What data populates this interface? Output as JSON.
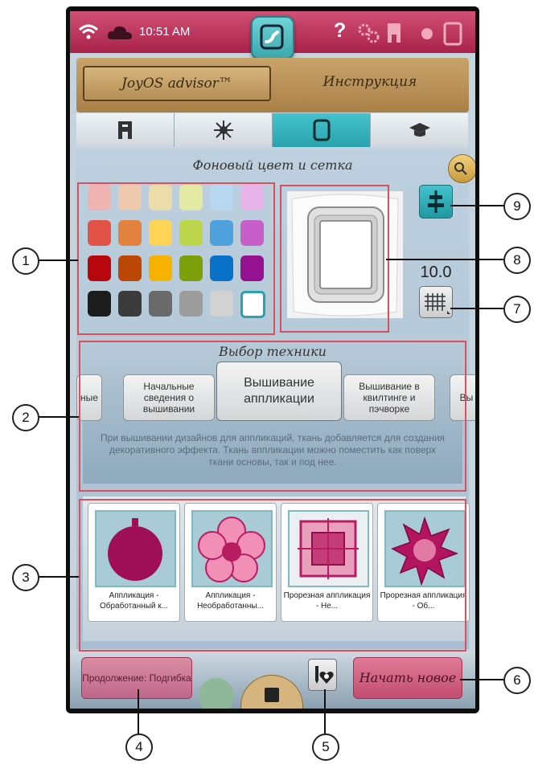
{
  "status_bar": {
    "time": "10:51 AM",
    "icons": [
      "wifi-icon",
      "cloud-icon",
      "home-icon",
      "help-icon",
      "settings-icon",
      "embroidery-unit-icon",
      "toggle-icon",
      "tablet-icon"
    ],
    "help_glyph": "?"
  },
  "header": {
    "advisor_button": "JoyOS advisor™",
    "instruction_button": "Инструкция"
  },
  "tabs": [
    {
      "icon": "sewing-machine-icon",
      "active": false
    },
    {
      "icon": "star-stitch-icon",
      "active": false
    },
    {
      "icon": "embroidery-hoop-icon",
      "active": true
    },
    {
      "icon": "graduation-cap-icon",
      "active": false
    }
  ],
  "background_section": {
    "title": "Фоновый цвет и сетка",
    "swatches": [
      "#efb3b1",
      "#efc9ae",
      "#ecdcaa",
      "#e2eaa4",
      "#b6d7ef",
      "#e8b5eb",
      "#e35246",
      "#e3823e",
      "#ffd455",
      "#bdd54a",
      "#4ea1dc",
      "#c85fc8",
      "#b7070d",
      "#bc4705",
      "#f7b200",
      "#7d9f09",
      "#0872c8",
      "#95118f",
      "#1c1c1c",
      "#3b3b3b",
      "#6a6a6a",
      "#9c9c9c",
      "#d2d2d2",
      "#ffffff"
    ],
    "selected_swatch_index": 23,
    "grid_size": "10.0"
  },
  "technique_section": {
    "title": "Выбор техники",
    "items": [
      {
        "label": "ные",
        "selected": false
      },
      {
        "label": "Начальные сведения о вышивании",
        "selected": false
      },
      {
        "label": "Вышивание аппликации",
        "selected": true
      },
      {
        "label": "Вышивание в квилтинге и пэчворке",
        "selected": false
      },
      {
        "label": "Вы",
        "selected": false
      }
    ],
    "description": "При вышивании дизайнов для аппликаций, ткань добавляется для создания декоративного эффекта. Ткань аппликации можно поместить как поверх ткани основы, так и под нее."
  },
  "designs": [
    {
      "caption": "Аппликация - Обработанный к...",
      "icon": "ornament-ball-icon"
    },
    {
      "caption": "Аппликация - Необработанны...",
      "icon": "flower-icon"
    },
    {
      "caption": "Прорезная аппликация - Не...",
      "icon": "square-patch-icon"
    },
    {
      "caption": "Прорезная аппликация - Об...",
      "icon": "star-icon"
    }
  ],
  "bottom_bar": {
    "continue_button": "Продолжение: Подгибка",
    "start_new_button": "Начать новое"
  },
  "callouts": [
    "1",
    "2",
    "3",
    "4",
    "5",
    "6",
    "7",
    "8",
    "9"
  ],
  "colors": {
    "accent": "#3aa7ae",
    "status_bar": "#c43a64",
    "highlight_box": "#d8515e"
  }
}
